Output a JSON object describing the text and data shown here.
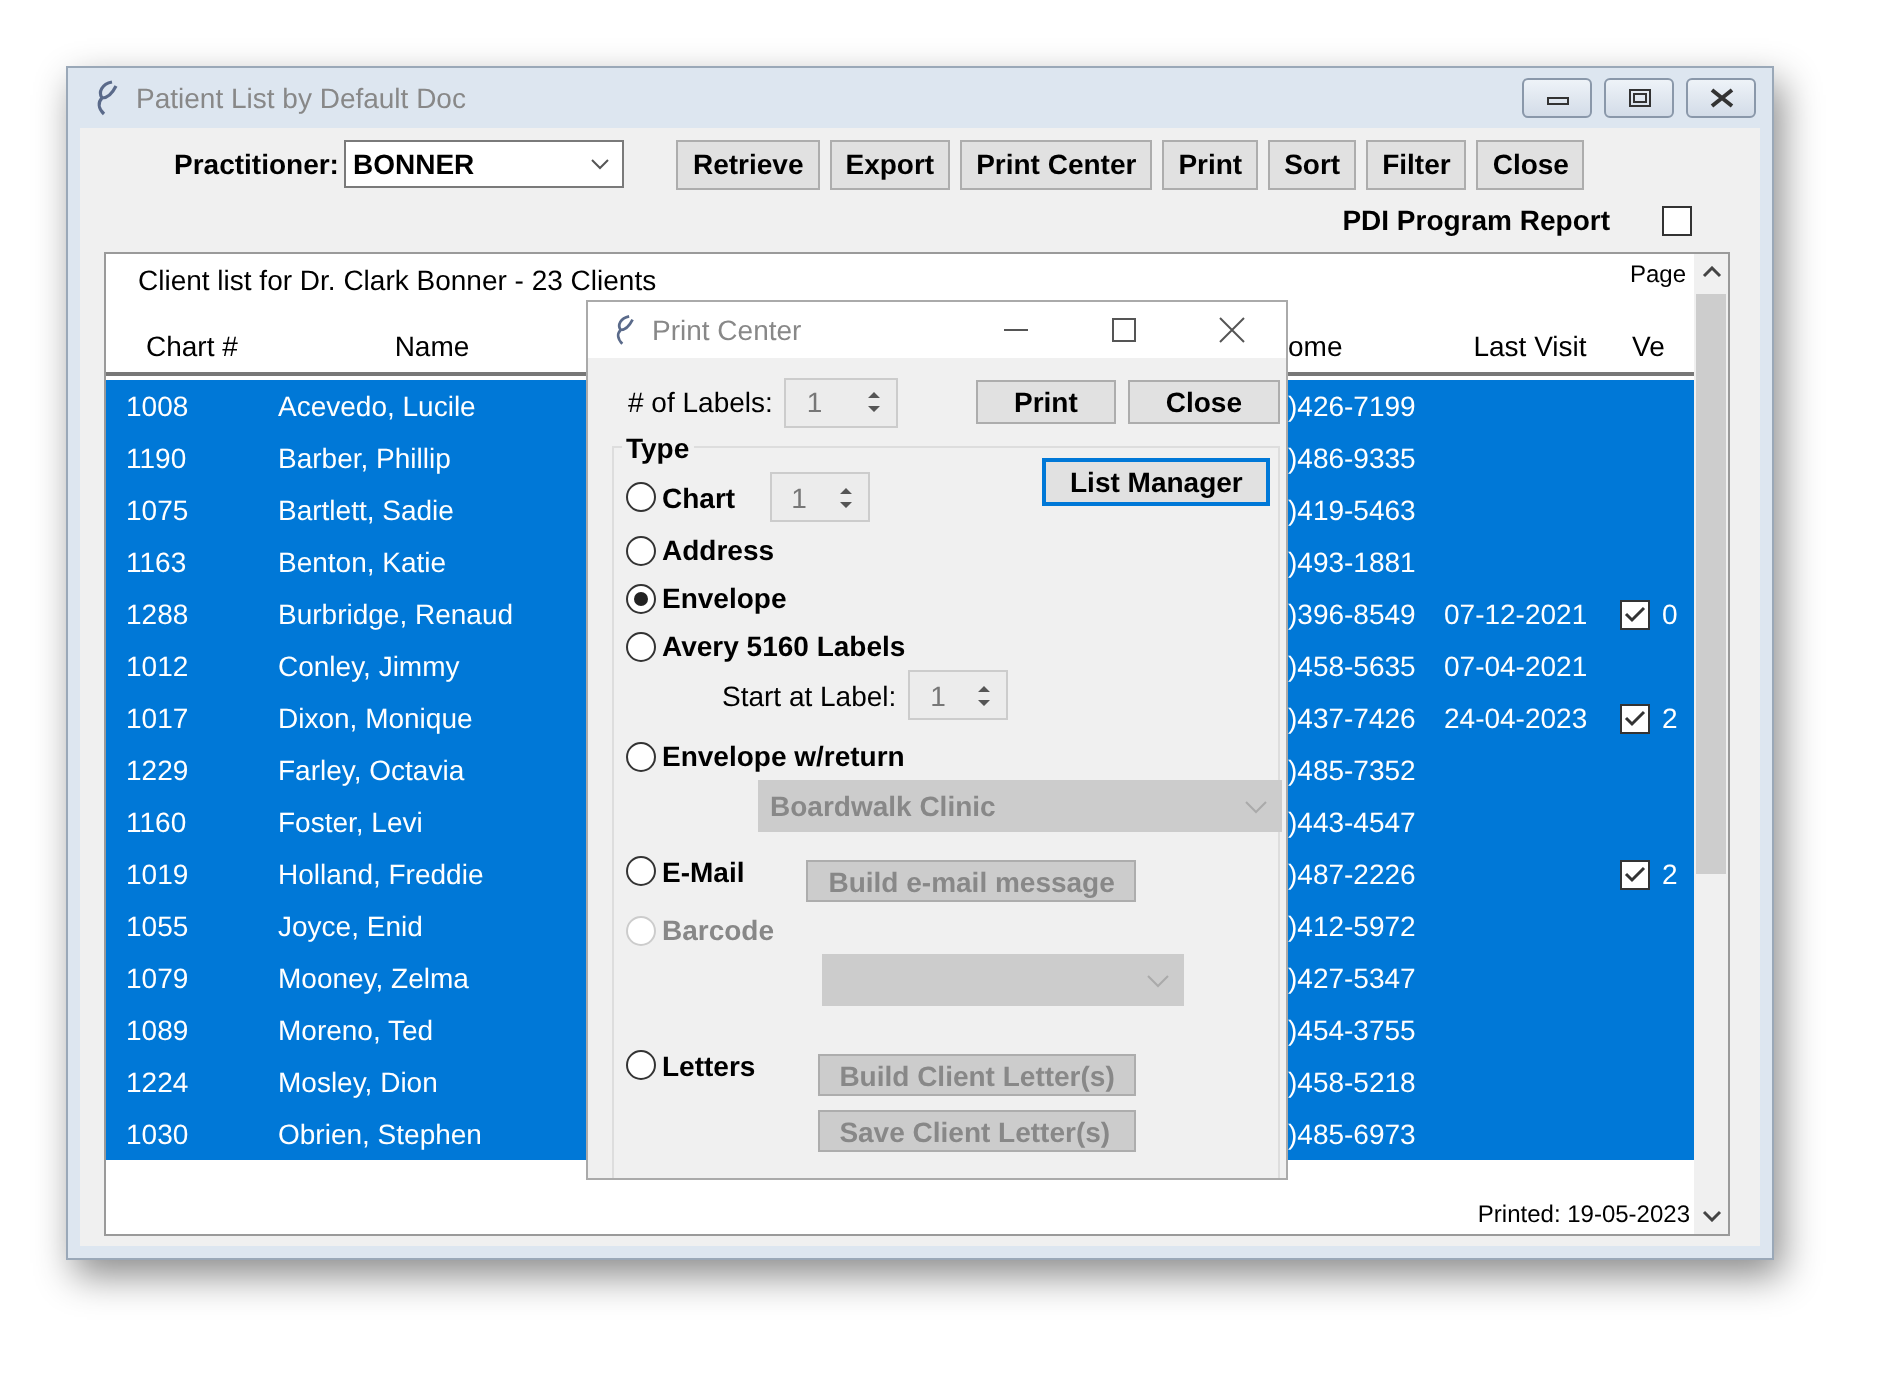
{
  "window": {
    "title": "Patient List by Default Doc"
  },
  "toolbar": {
    "practitioner_label": "Practitioner:",
    "practitioner": "BONNER",
    "buttons": [
      "Retrieve",
      "Export",
      "Print Center",
      "Print",
      "Sort",
      "Filter",
      "Close"
    ]
  },
  "pdi_report": {
    "label": "PDI Program Report",
    "checked": false
  },
  "report": {
    "heading": "Client list for Dr. Clark Bonner - 23 Clients",
    "page_label": "Page",
    "columns": [
      "Chart #",
      "Name",
      "ome",
      "Last Visit",
      "Ve"
    ],
    "rows": [
      {
        "chart": "1008",
        "name": "Acevedo, Lucile",
        "home": ")426-7199",
        "last_visit": "",
        "verified": false,
        "ve": "",
        "selected": true
      },
      {
        "chart": "1190",
        "name": "Barber, Phillip",
        "home": ")486-9335",
        "last_visit": "",
        "verified": false,
        "ve": "",
        "selected": true
      },
      {
        "chart": "1075",
        "name": "Bartlett, Sadie",
        "home": ")419-5463",
        "last_visit": "",
        "verified": false,
        "ve": "",
        "selected": true
      },
      {
        "chart": "1163",
        "name": "Benton, Katie",
        "home": ")493-1881",
        "last_visit": "",
        "verified": false,
        "ve": "",
        "selected": true
      },
      {
        "chart": "1288",
        "name": "Burbridge, Renaud",
        "home": ")396-8549",
        "last_visit": "07-12-2021",
        "verified": true,
        "ve": "0",
        "selected": true
      },
      {
        "chart": "1012",
        "name": "Conley, Jimmy",
        "home": ")458-5635",
        "last_visit": "07-04-2021",
        "verified": false,
        "ve": "",
        "selected": true
      },
      {
        "chart": "1017",
        "name": "Dixon, Monique",
        "home": ")437-7426",
        "last_visit": "24-04-2023",
        "verified": true,
        "ve": "2",
        "selected": true
      },
      {
        "chart": "1229",
        "name": "Farley, Octavia",
        "home": ")485-7352",
        "last_visit": "",
        "verified": false,
        "ve": "",
        "selected": true
      },
      {
        "chart": "1160",
        "name": "Foster, Levi",
        "home": ")443-4547",
        "last_visit": "",
        "verified": false,
        "ve": "",
        "selected": true
      },
      {
        "chart": "1019",
        "name": "Holland, Freddie",
        "home": ")487-2226",
        "last_visit": "",
        "verified": true,
        "ve": "2",
        "selected": true
      },
      {
        "chart": "1055",
        "name": "Joyce, Enid",
        "home": ")412-5972",
        "last_visit": "",
        "verified": false,
        "ve": "",
        "selected": true
      },
      {
        "chart": "1079",
        "name": "Mooney, Zelma",
        "home": ")427-5347",
        "last_visit": "",
        "verified": false,
        "ve": "",
        "selected": true
      },
      {
        "chart": "1089",
        "name": "Moreno, Ted",
        "home": ")454-3755",
        "last_visit": "",
        "verified": false,
        "ve": "",
        "selected": true
      },
      {
        "chart": "1224",
        "name": "Mosley, Dion",
        "home": ")458-5218",
        "last_visit": "",
        "verified": false,
        "ve": "",
        "selected": true
      },
      {
        "chart": "1030",
        "name": "Obrien, Stephen",
        "home": ")485-6973",
        "last_visit": "",
        "verified": false,
        "ve": "",
        "selected": true
      }
    ],
    "footer": "Printed: 19-05-2023"
  },
  "dialog": {
    "title": "Print Center",
    "labels_label": "# of Labels:",
    "labels_value": "1",
    "buttons": [
      "Print",
      "Close"
    ],
    "list_manager": {
      "label": "List Manager",
      "focused": true
    },
    "type_label": "Type",
    "options": [
      {
        "kind": "spinner",
        "label": "Chart",
        "selected": false,
        "disabled": false,
        "value": "1"
      },
      {
        "kind": "plain",
        "label": "Address",
        "selected": false,
        "disabled": false
      },
      {
        "kind": "plain",
        "label": "Envelope",
        "selected": true,
        "disabled": false
      },
      {
        "kind": "start_label",
        "label": "Avery 5160 Labels",
        "selected": false,
        "disabled": false,
        "sub_label": "Start at Label:",
        "value": "1"
      },
      {
        "kind": "dropdown",
        "label": "Envelope w/return",
        "selected": false,
        "disabled": false,
        "value": "Boardwalk Clinic",
        "control_disabled": true
      },
      {
        "kind": "buttons",
        "label": "E-Mail",
        "selected": false,
        "disabled": false,
        "buttons": [
          "Build e-mail message"
        ],
        "control_disabled": true
      },
      {
        "kind": "dropdown",
        "label": "Barcode",
        "selected": false,
        "disabled": true,
        "control_disabled": true
      },
      {
        "kind": "buttons",
        "label": "Letters",
        "selected": false,
        "disabled": false,
        "buttons": [
          "Build Client Letter(s)",
          "Save Client Letter(s)"
        ],
        "control_disabled": true
      }
    ]
  }
}
